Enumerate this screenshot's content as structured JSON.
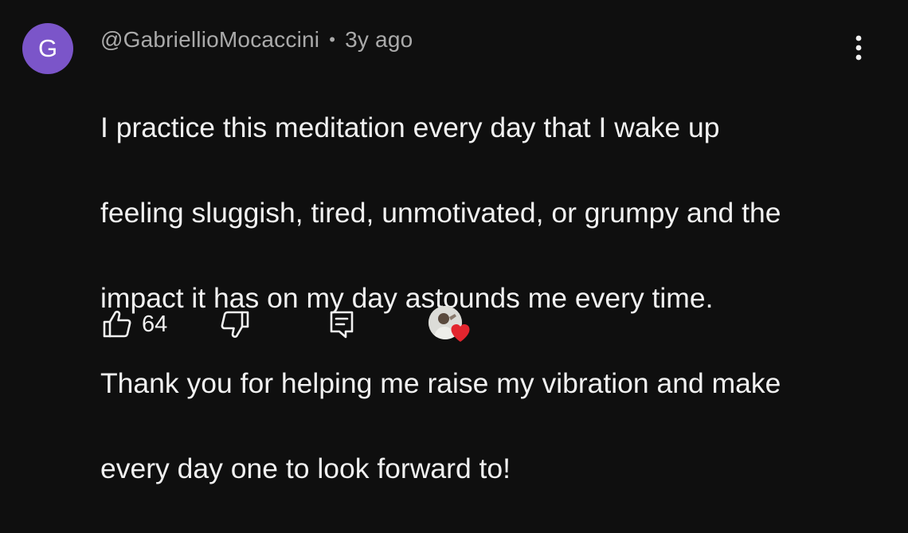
{
  "comment": {
    "avatar_letter": "G",
    "avatar_color": "#7b55c9",
    "author": "@GabriellioMocaccini",
    "separator": "•",
    "time_ago": "3y ago",
    "text_lines": [
      "I practice this meditation every day that I wake up",
      "feeling sluggish, tired, unmotivated, or grumpy and the",
      "impact it has on my day astounds me every time.",
      "Thank you for helping me raise my vibration and make",
      "every day one to look forward to!"
    ]
  },
  "actions": {
    "like_icon": "thumbs-up-icon",
    "like_count": "64",
    "dislike_icon": "thumbs-down-icon",
    "reply_icon": "reply-icon",
    "creator_heart_icon": "heart-icon",
    "menu_icon": "more-vert-icon"
  },
  "colors": {
    "background": "#0f0f0f",
    "text_primary": "#f1f1f1",
    "text_secondary": "#aaaaaa",
    "heart": "#e3252e"
  }
}
